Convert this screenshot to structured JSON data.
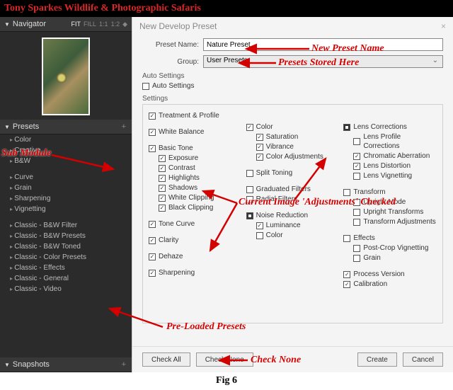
{
  "overlay_title": "Tony Sparkes Wildlife & Photographic Safaris",
  "figure_label": "Fig 6",
  "annotations": {
    "sub_module": "Sub Module",
    "new_preset_name": "New Preset Name",
    "presets_stored": "Presets Stored Here",
    "adjustments_checked": "Current Image 'Adjustments' Checked",
    "preloaded": "Pre-Loaded Presets",
    "check_none": "Check None"
  },
  "left": {
    "navigator_label": "Navigator",
    "fit": "FIT",
    "fill": "FILL",
    "one": "1:1",
    "ratio": "1:2",
    "presets_label": "Presets",
    "snapshots_label": "Snapshots",
    "groups": [
      {
        "label": "Color"
      },
      {
        "label": "Creative"
      },
      {
        "label": "B&W"
      }
    ],
    "groups2": [
      {
        "label": "Curve"
      },
      {
        "label": "Grain"
      },
      {
        "label": "Sharpening"
      },
      {
        "label": "Vignetting"
      }
    ],
    "groups3": [
      {
        "label": "Classic - B&W Filter"
      },
      {
        "label": "Classic - B&W Presets"
      },
      {
        "label": "Classic - B&W Toned"
      },
      {
        "label": "Classic - Color Presets"
      },
      {
        "label": "Classic - Effects"
      },
      {
        "label": "Classic - General"
      },
      {
        "label": "Classic - Video"
      }
    ]
  },
  "dialog": {
    "title": "New Develop Preset",
    "preset_name_label": "Preset Name:",
    "preset_name_value": "Nature Preset",
    "group_label": "Group:",
    "group_value": "User Presets",
    "auto_settings_label": "Auto Settings",
    "auto_settings_chk": "Auto Settings",
    "settings_label": "Settings",
    "col1": {
      "treatment": "Treatment & Profile",
      "white_balance": "White Balance",
      "basic_tone": "Basic Tone",
      "exposure": "Exposure",
      "contrast": "Contrast",
      "highlights": "Highlights",
      "shadows": "Shadows",
      "white_clip": "White Clipping",
      "black_clip": "Black Clipping",
      "tone_curve": "Tone Curve",
      "clarity": "Clarity",
      "dehaze": "Dehaze",
      "sharpening": "Sharpening"
    },
    "col2": {
      "color": "Color",
      "saturation": "Saturation",
      "vibrance": "Vibrance",
      "color_adj": "Color Adjustments",
      "split": "Split Toning",
      "grad": "Graduated Filters",
      "radial": "Radial Filters",
      "noise": "Noise Reduction",
      "luminance": "Luminance",
      "ncolor": "Color"
    },
    "col3": {
      "lens": "Lens Corrections",
      "profile": "Lens Profile Corrections",
      "chroma": "Chromatic Aberration",
      "distort": "Lens Distortion",
      "vignet": "Lens Vignetting",
      "transform": "Transform",
      "upright": "Upright Mode",
      "utrans": "Upright Transforms",
      "tadjust": "Transform Adjustments",
      "effects": "Effects",
      "pcv": "Post-Crop Vignetting",
      "grain": "Grain",
      "pversion": "Process Version",
      "calib": "Calibration"
    },
    "buttons": {
      "check_all": "Check All",
      "check_none": "Check None",
      "create": "Create",
      "cancel": "Cancel"
    }
  }
}
